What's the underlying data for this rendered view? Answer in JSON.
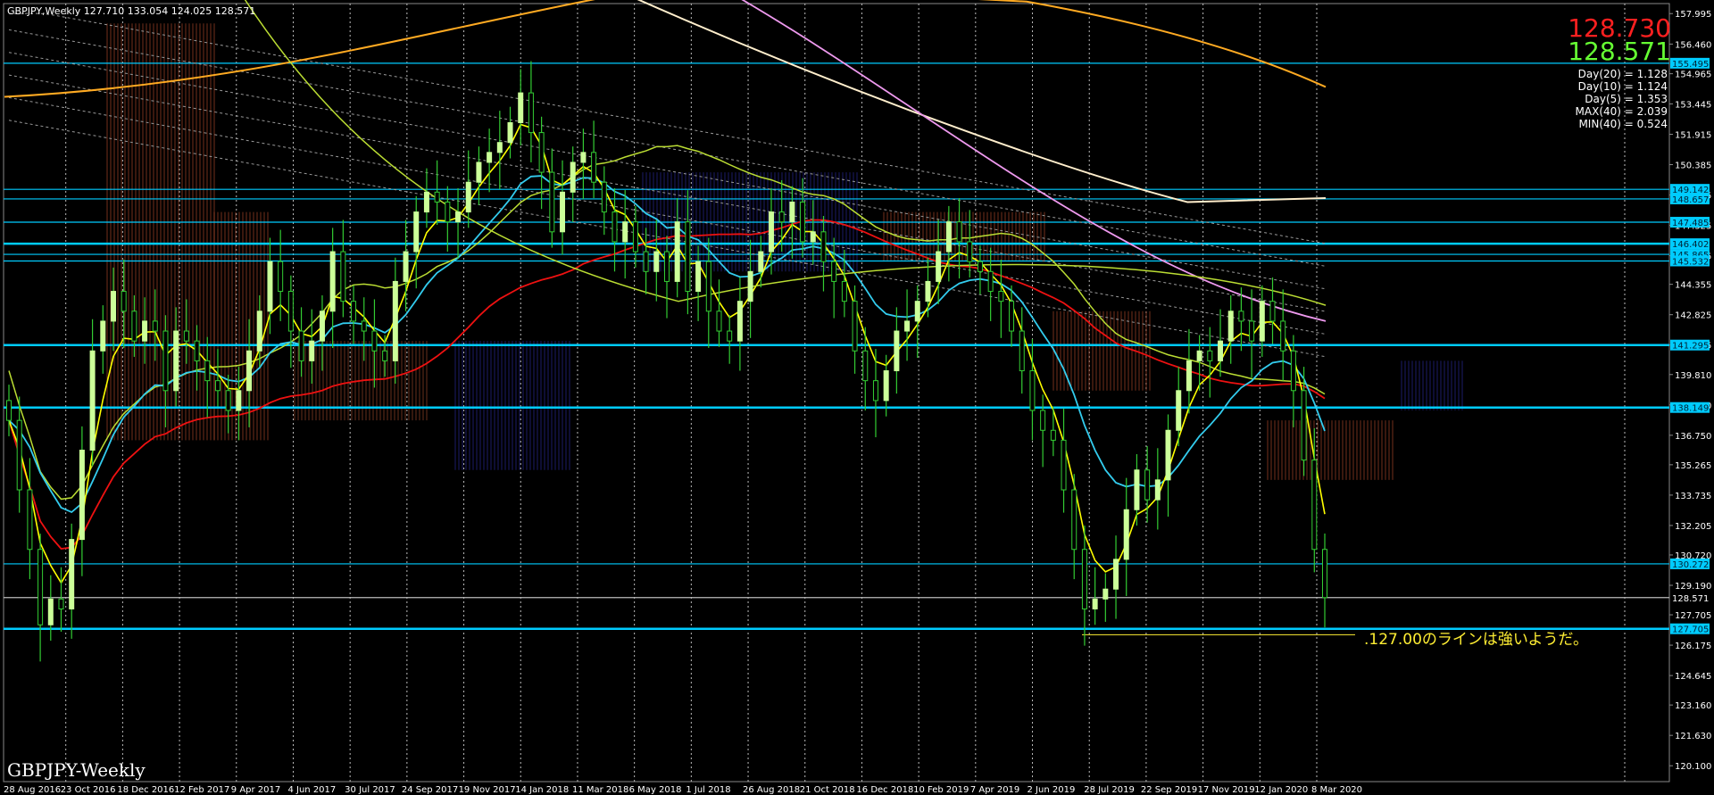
{
  "header": "GBPJPY,Weekly  127.710 133.054 124.025 128.571",
  "watermark": "GBPJPY-Weekly",
  "prices": {
    "ask": "128.730",
    "bid": "128.571",
    "ask_color": "#ff2020",
    "bid_color": "#66ff33"
  },
  "stats": [
    "Day(20) = 1.128",
    "Day(10) = 1.124",
    "Day(5) = 1.353",
    "MAX(40) = 2.039",
    "MIN(40) = 0.524"
  ],
  "annotation": ".127.00のラインは強いようだ。",
  "colors": {
    "bg": "#000000",
    "bull": "#ccff99",
    "bear": "#33cc33",
    "hline": "#00ccff",
    "ema_fast": "#ffff00",
    "ema_mid": "#33ccee",
    "sma_red": "#ee1111",
    "sma_lime": "#bbdd33",
    "sma_orange": "#ffaa22",
    "sma_cream": "#ffeecc",
    "sma_pink": "#ee99ee"
  },
  "chart_data": {
    "type": "candlestick",
    "symbol": "GBPJPY",
    "timeframe": "Weekly",
    "ylim": [
      119.3,
      158.5
    ],
    "y_ticks": [
      "157.995",
      "156.460",
      "154.965",
      "153.445",
      "151.915",
      "150.385",
      "148.855",
      "147.325",
      "145.795",
      "144.355",
      "142.825",
      "141.295",
      "139.810",
      "138.280",
      "136.750",
      "135.265",
      "133.735",
      "132.205",
      "130.720",
      "129.190",
      "127.705",
      "126.175",
      "124.645",
      "123.160",
      "121.630",
      "120.100"
    ],
    "x_ticks": [
      "28 Aug 2016",
      "23 Oct 2016",
      "18 Dec 2016",
      "12 Feb 2017",
      "9 Apr 2017",
      "4 Jun 2017",
      "30 Jul 2017",
      "24 Sep 2017",
      "19 Nov 2017",
      "14 Jan 2018",
      "11 Mar 2018",
      "6 May 2018",
      "1 Jul 2018",
      "26 Aug 2018",
      "21 Oct 2018",
      "16 Dec 2018",
      "10 Feb 2019",
      "7 Apr 2019",
      "2 Jun 2019",
      "28 Jul 2019",
      "22 Sep 2019",
      "17 Nov 2019",
      "12 Jan 2020",
      "8 Mar 2020"
    ],
    "horizontal_levels": [
      155.495,
      149.142,
      148.657,
      147.485,
      146.402,
      145.865,
      145.532,
      141.295,
      138.149,
      130.272,
      128.571,
      127.0
    ],
    "level_labels": [
      "155.495",
      "149.142",
      "148.657",
      "147.485",
      "146.402",
      "145.865",
      "145.532",
      "141.295",
      "138.149",
      "130.272",
      "128.571",
      "127.705"
    ],
    "close_weekly": [
      137.5,
      134.0,
      131.0,
      127.2,
      128.5,
      128.0,
      131.5,
      136.0,
      141.0,
      142.5,
      144.0,
      143.0,
      141.5,
      142.5,
      142.0,
      139.0,
      142.0,
      141.5,
      140.5,
      139.5,
      139.0,
      138.0,
      139.0,
      141.0,
      143.0,
      145.5,
      144.0,
      142.0,
      140.5,
      141.5,
      143.0,
      146.0,
      143.5,
      142.5,
      142.0,
      141.0,
      140.5,
      144.5,
      146.0,
      148.0,
      149.0,
      148.5,
      147.5,
      148.0,
      149.5,
      150.5,
      151.0,
      151.5,
      152.5,
      154.0,
      152.0,
      150.0,
      147.0,
      149.0,
      150.5,
      151.0,
      149.5,
      148.0,
      146.5,
      147.5,
      146.0,
      145.0,
      146.0,
      144.5,
      147.5,
      144.0,
      145.5,
      143.0,
      142.0,
      141.5,
      143.5,
      145.0,
      146.0,
      148.0,
      147.5,
      148.5,
      146.5,
      147.0,
      145.5,
      144.5,
      143.5,
      141.0,
      139.5,
      138.5,
      140.0,
      142.0,
      142.5,
      143.5,
      144.5,
      146.0,
      147.5,
      146.5,
      145.5,
      145.0,
      144.0,
      143.5,
      142.0,
      140.0,
      138.0,
      137.0,
      136.5,
      134.0,
      131.0,
      128.0,
      128.5,
      129.0,
      130.5,
      133.0,
      135.0,
      133.5,
      134.5,
      137.0,
      139.0,
      140.5,
      141.0,
      140.5,
      141.5,
      143.0,
      142.5,
      141.5,
      143.5,
      142.5,
      141.0,
      139.0,
      135.5,
      131.0,
      128.571
    ]
  }
}
